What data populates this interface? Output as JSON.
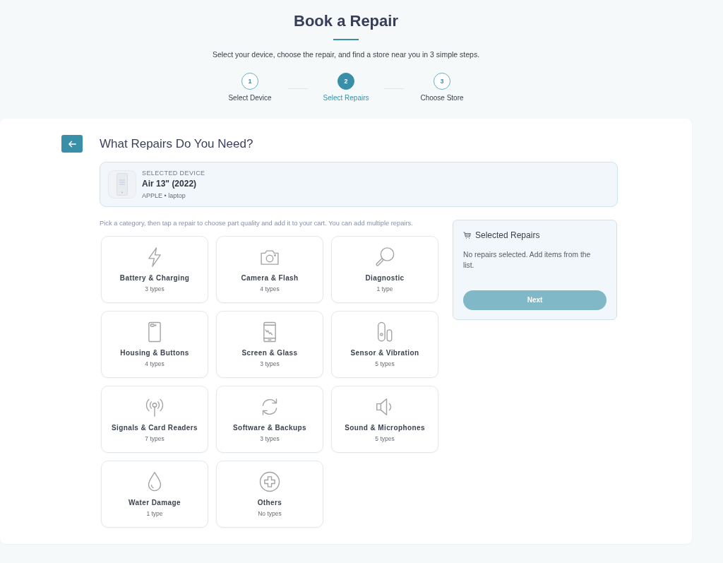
{
  "header": {
    "title": "Book a Repair",
    "subtitle": "Select your device, choose the repair, and find a store near you in 3 simple steps."
  },
  "steps": [
    {
      "number": "1",
      "label": "Select Device",
      "selected": false
    },
    {
      "number": "2",
      "label": "Select Repairs",
      "selected": true
    },
    {
      "number": "3",
      "label": "Choose Store",
      "selected": false
    }
  ],
  "panel": {
    "heading": "What Repairs Do You Need?"
  },
  "selected_device": {
    "caption": "SELECTED DEVICE",
    "name": "Air 13\" (2022)",
    "details": "APPLE • laptop"
  },
  "hint": "Pick a category, then tap a repair to choose part quality and add it to your cart. You can add multiple repairs.",
  "categories": [
    {
      "kind": "bolt",
      "name": "Battery & Charging",
      "count": "3 types"
    },
    {
      "kind": "camera",
      "name": "Camera & Flash",
      "count": "4 types"
    },
    {
      "kind": "magnifier",
      "name": "Diagnostic",
      "count": "1 type"
    },
    {
      "kind": "handset",
      "name": "Housing & Buttons",
      "count": "4 types"
    },
    {
      "kind": "screen",
      "name": "Screen & Glass",
      "count": "3 types"
    },
    {
      "kind": "capsules",
      "name": "Sensor & Vibration",
      "count": "5 types"
    },
    {
      "kind": "antenna",
      "name": "Signals & Card Readers",
      "count": "7 types"
    },
    {
      "kind": "cycle",
      "name": "Software & Backups",
      "count": "3 types"
    },
    {
      "kind": "speaker",
      "name": "Sound & Microphones",
      "count": "5 types"
    },
    {
      "kind": "drop",
      "name": "Water Damage",
      "count": "1 type"
    },
    {
      "kind": "plus",
      "name": "Others",
      "count": "No types"
    }
  ],
  "cart": {
    "title": "Selected Repairs",
    "empty_message": "No repairs selected. Add items from the list.",
    "next_button": {
      "label": "Next",
      "disabled": true
    }
  }
}
